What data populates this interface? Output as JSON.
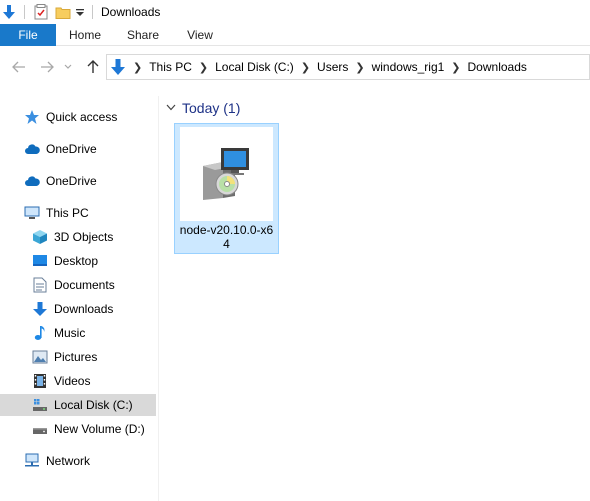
{
  "window": {
    "title": "Downloads"
  },
  "ribbon": {
    "tabs": [
      {
        "label": "File"
      },
      {
        "label": "Home"
      },
      {
        "label": "Share"
      },
      {
        "label": "View"
      }
    ]
  },
  "address": {
    "crumbs": [
      "This PC",
      "Local Disk (C:)",
      "Users",
      "windows_rig1",
      "Downloads"
    ]
  },
  "sidebar": {
    "items": [
      {
        "label": "Quick access",
        "icon": "star-icon"
      },
      {
        "label": "OneDrive",
        "icon": "cloud-icon"
      },
      {
        "label": "OneDrive",
        "icon": "cloud-icon"
      },
      {
        "label": "This PC",
        "icon": "computer-icon"
      },
      {
        "label": "3D Objects",
        "icon": "cube-icon"
      },
      {
        "label": "Desktop",
        "icon": "desktop-icon"
      },
      {
        "label": "Documents",
        "icon": "document-icon"
      },
      {
        "label": "Downloads",
        "icon": "download-arrow-icon"
      },
      {
        "label": "Music",
        "icon": "music-note-icon"
      },
      {
        "label": "Pictures",
        "icon": "picture-icon"
      },
      {
        "label": "Videos",
        "icon": "film-icon"
      },
      {
        "label": "Local Disk (C:)",
        "icon": "drive-icon",
        "selected": true
      },
      {
        "label": "New Volume (D:)",
        "icon": "drive-icon"
      },
      {
        "label": "Network",
        "icon": "network-icon"
      }
    ]
  },
  "content": {
    "group_label": "Today (1)",
    "files": [
      {
        "name": "node-v20.10.0-x64",
        "icon": "installer-package-icon",
        "selected": true
      }
    ]
  },
  "colors": {
    "accent": "#1979ca",
    "selection_fill": "#cce8ff",
    "selection_border": "#99d1ff",
    "group_header": "#1e3287"
  }
}
